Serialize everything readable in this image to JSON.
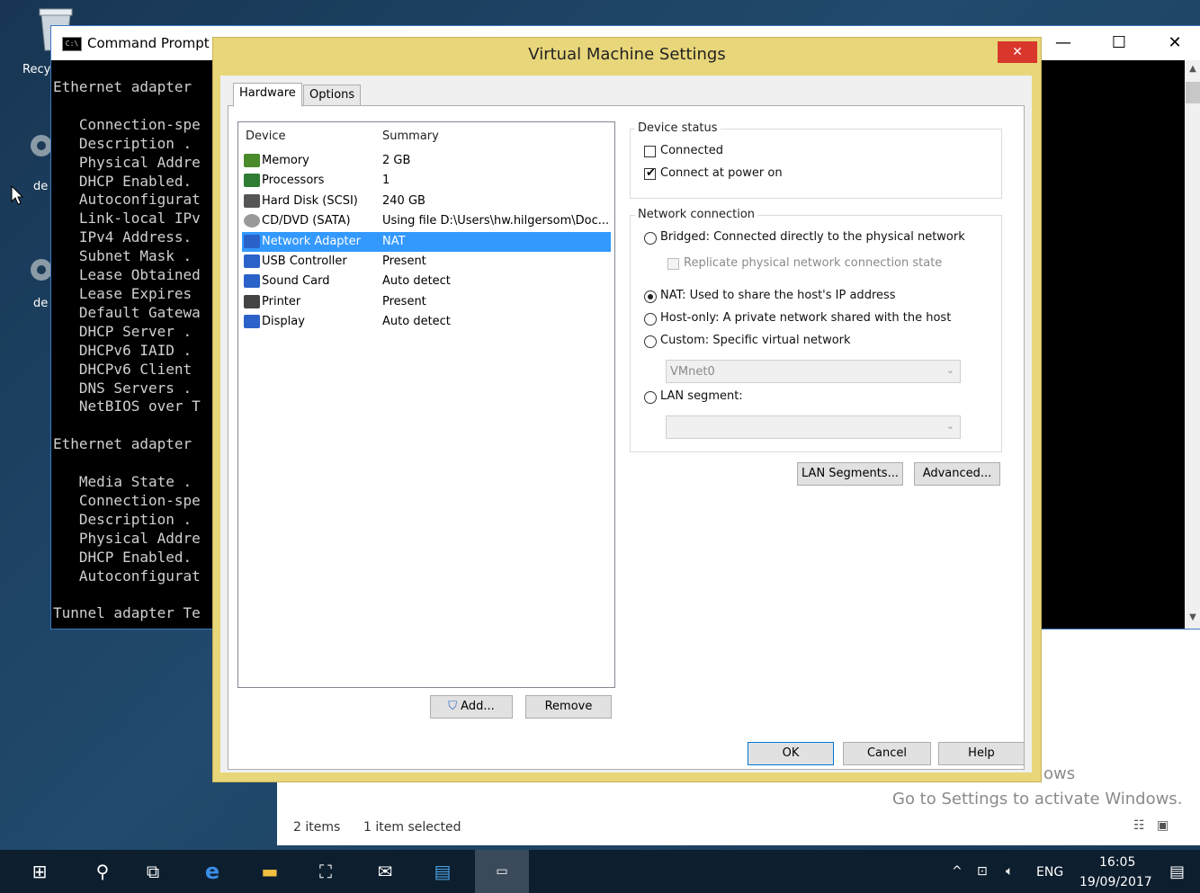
{
  "desktop": {
    "labels": [
      "Recy",
      "de",
      "de"
    ]
  },
  "console": {
    "title": "Command Prompt",
    "icon_text": "C:\\",
    "minimize": "—",
    "maximize": "☐",
    "close": "✕",
    "lines": [
      "Ethernet adapter",
      "",
      "   Connection-spe",
      "   Description .",
      "   Physical Addre",
      "   DHCP Enabled.",
      "   Autoconfigurat",
      "   Link-local IPv",
      "   IPv4 Address.",
      "   Subnet Mask .",
      "   Lease Obtained",
      "   Lease Expires",
      "   Default Gatewa",
      "   DHCP Server .",
      "   DHCPv6 IAID .",
      "   DHCPv6 Client",
      "   DNS Servers .",
      "   NetBIOS over T",
      "",
      "Ethernet adapter",
      "",
      "   Media State .",
      "   Connection-spe",
      "   Description .",
      "   Physical Addre",
      "   DHCP Enabled.",
      "   Autoconfigurat",
      "",
      "Tunnel adapter Te"
    ]
  },
  "explorer": {
    "item_count": "2 items",
    "selected": "1 item selected"
  },
  "watermark": {
    "line1": "ows",
    "line2": "Go to Settings to activate Windows."
  },
  "dialog": {
    "title": "Virtual Machine Settings",
    "close": "✕",
    "tabs": [
      "Hardware",
      "Options"
    ],
    "device_header": "Device",
    "summary_header": "Summary",
    "devices": [
      {
        "name": "Memory",
        "summary": "2 GB",
        "icon": "memory-icon"
      },
      {
        "name": "Processors",
        "summary": "1",
        "icon": "processor-icon"
      },
      {
        "name": "Hard Disk (SCSI)",
        "summary": "240 GB",
        "icon": "hard-disk-icon"
      },
      {
        "name": "CD/DVD (SATA)",
        "summary": "Using file D:\\Users\\hw.hilgersom\\Doc...",
        "icon": "cd-dvd-icon"
      },
      {
        "name": "Network Adapter",
        "summary": "NAT",
        "icon": "network-adapter-icon",
        "selected": true
      },
      {
        "name": "USB Controller",
        "summary": "Present",
        "icon": "usb-icon"
      },
      {
        "name": "Sound Card",
        "summary": "Auto detect",
        "icon": "sound-icon"
      },
      {
        "name": "Printer",
        "summary": "Present",
        "icon": "printer-icon"
      },
      {
        "name": "Display",
        "summary": "Auto detect",
        "icon": "display-icon"
      }
    ],
    "add_label": "Add...",
    "remove_label": "Remove",
    "device_status": {
      "label": "Device status",
      "connected": "Connected",
      "connect_power_on": "Connect at power on"
    },
    "network_connection": {
      "label": "Network connection",
      "bridged": "Bridged: Connected directly to the physical network",
      "replicate": "Replicate physical network connection state",
      "nat": "NAT: Used to share the host's IP address",
      "host_only": "Host-only: A private network shared with the host",
      "custom": "Custom: Specific virtual network",
      "vmnet_value": "VMnet0",
      "lan_segment": "LAN segment:",
      "lan_value": ""
    },
    "lan_segments_btn": "LAN Segments...",
    "advanced_btn": "Advanced...",
    "ok": "OK",
    "cancel": "Cancel",
    "help": "Help"
  },
  "taskbar": {
    "lang": "ENG",
    "time": "16:05",
    "date": "19/09/2017"
  },
  "colors": {
    "dialog_frame": "#e8d67a",
    "selection": "#3399ff",
    "close_red": "#d9372c"
  }
}
